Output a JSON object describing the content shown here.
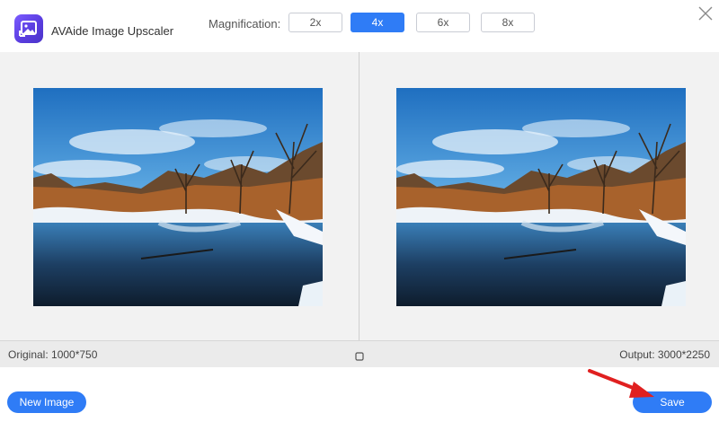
{
  "header": {
    "app_title": "AVAide Image Upscaler",
    "logo_icon": "photo-upscale-logo",
    "magnification_label": "Magnification:",
    "magnification_options": [
      "2x",
      "4x",
      "6x",
      "8x"
    ],
    "selected_magnification": "4x",
    "close_icon": "close-icon"
  },
  "preview": {
    "original_info": "Original: 1000*750",
    "output_info": "Output: 3000*2250",
    "compare_icon": "square-compare-icon"
  },
  "footer": {
    "new_image_label": "New Image",
    "save_label": "Save"
  },
  "colors": {
    "accent": "#2f7cf6",
    "annotation_arrow": "#e02020"
  }
}
